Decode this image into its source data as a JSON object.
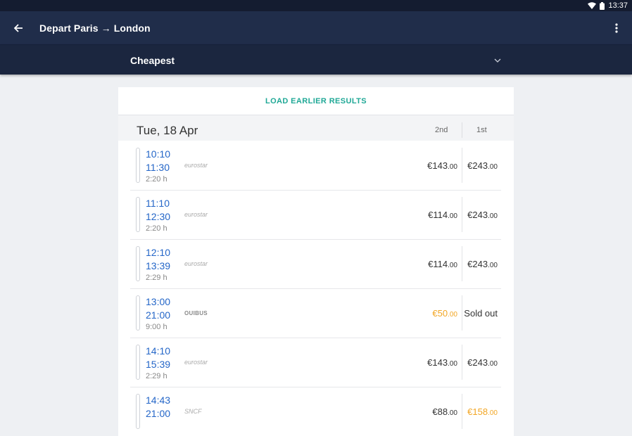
{
  "status": {
    "time": "13:37"
  },
  "appbar": {
    "title": "Depart Paris → London"
  },
  "sort": {
    "selected": "Cheapest"
  },
  "load_earlier": "LOAD EARLIER RESULTS",
  "date_header": {
    "date": "Tue, 18 Apr",
    "class_2nd": "2nd",
    "class_1st": "1st"
  },
  "colors": {
    "appbar": "#202d4a",
    "accent": "#1fa896",
    "time": "#2466c8",
    "cheap": "#f2a624"
  },
  "journeys": [
    {
      "dep": "10:10",
      "arr": "11:30",
      "dur": "2:20 h",
      "carrier": "eurostar",
      "p2": "€143",
      "p2c": ".00",
      "p1": "€243",
      "p1c": ".00"
    },
    {
      "dep": "11:10",
      "arr": "12:30",
      "dur": "2:20 h",
      "carrier": "eurostar",
      "p2": "€114",
      "p2c": ".00",
      "p1": "€243",
      "p1c": ".00"
    },
    {
      "dep": "12:10",
      "arr": "13:39",
      "dur": "2:29 h",
      "carrier": "eurostar",
      "p2": "€114",
      "p2c": ".00",
      "p1": "€243",
      "p1c": ".00"
    },
    {
      "dep": "13:00",
      "arr": "21:00",
      "dur": "9:00 h",
      "carrier": "OUIBUS",
      "p2": "€50",
      "p2c": ".00",
      "p1": "Sold out",
      "p1c": ""
    },
    {
      "dep": "14:10",
      "arr": "15:39",
      "dur": "2:29 h",
      "carrier": "eurostar",
      "p2": "€143",
      "p2c": ".00",
      "p1": "€243",
      "p1c": ".00"
    },
    {
      "dep": "14:43",
      "arr": "21:00",
      "dur": "",
      "carrier": "SNCF",
      "p2": "€88",
      "p2c": ".00",
      "p1": "€158",
      "p1c": ".00"
    }
  ]
}
